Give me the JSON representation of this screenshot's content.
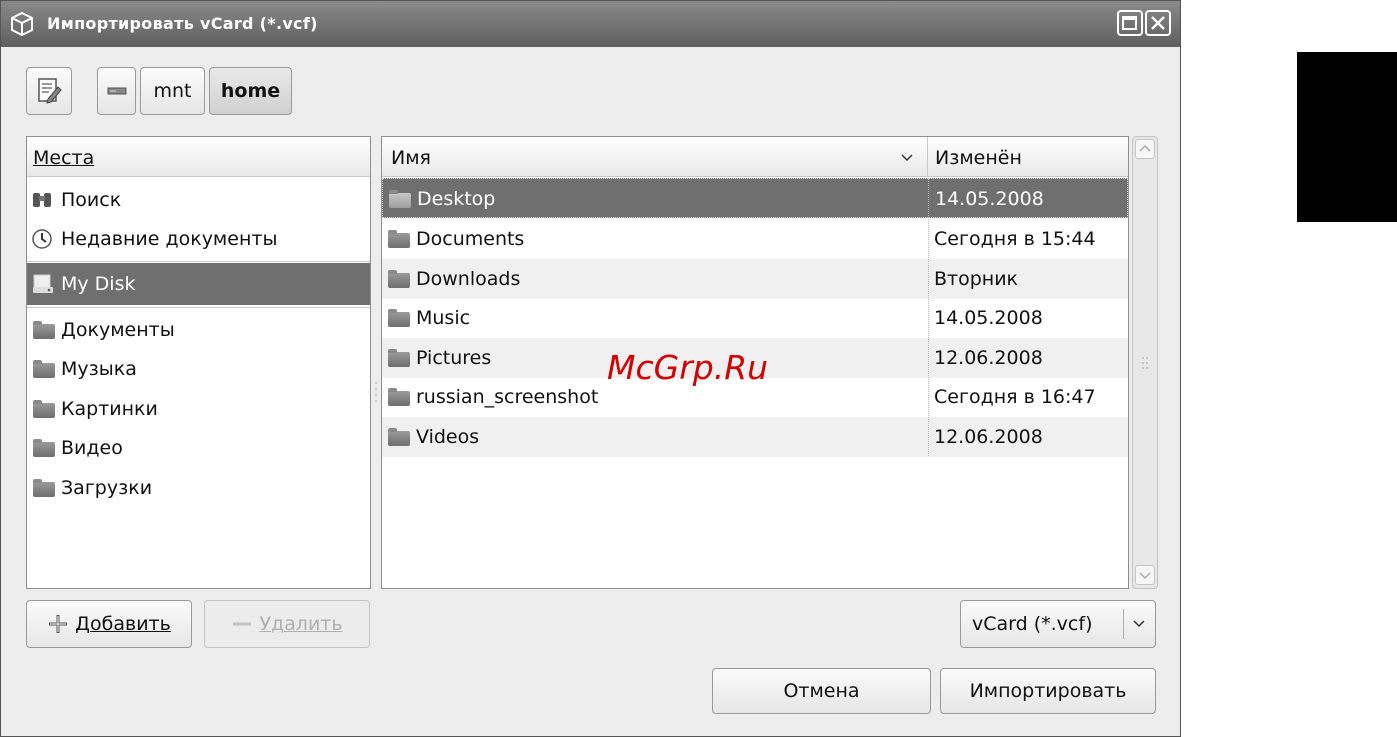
{
  "window": {
    "title": "Импортировать vCard (*.vcf)"
  },
  "path_bar": {
    "crumbs": [
      "mnt",
      "home"
    ]
  },
  "places": {
    "header": "Места",
    "items": [
      "Поиск",
      "Недавние документы",
      "My Disk",
      "Документы",
      "Музыка",
      "Картинки",
      "Видео",
      "Загрузки"
    ]
  },
  "files": {
    "col_name": "Имя",
    "col_modified": "Изменён",
    "rows": [
      {
        "name": "Desktop",
        "modified": "14.05.2008"
      },
      {
        "name": "Documents",
        "modified": "Сегодня в 15:44"
      },
      {
        "name": "Downloads",
        "modified": "Вторник"
      },
      {
        "name": "Music",
        "modified": "14.05.2008"
      },
      {
        "name": "Pictures",
        "modified": "12.06.2008"
      },
      {
        "name": "russian_screenshot",
        "modified": "Сегодня в 16:47"
      },
      {
        "name": "Videos",
        "modified": "12.06.2008"
      }
    ]
  },
  "buttons": {
    "add": "Добавить",
    "remove": "Удалить",
    "cancel": "Отмена",
    "import": "Импортировать"
  },
  "filter": {
    "selected": "vCard (*.vcf)"
  },
  "watermark": "McGrp.Ru",
  "colors": {
    "selected_row": "#6f6f6f",
    "titlebar": "#6e6e6e",
    "alt_row": "#f0f0f0"
  }
}
